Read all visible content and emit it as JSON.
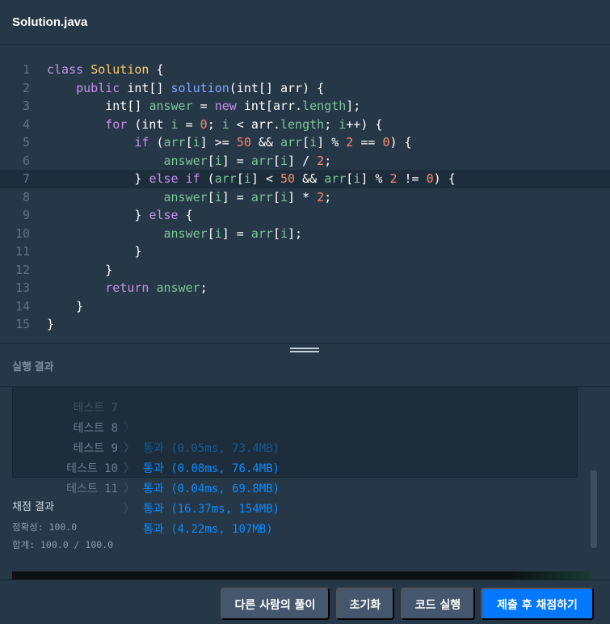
{
  "tab": {
    "title": "Solution.java"
  },
  "editor": {
    "line_numbers": [
      "1",
      "2",
      "3",
      "4",
      "5",
      "6",
      "7",
      "8",
      "9",
      "10",
      "11",
      "12",
      "13",
      "14",
      "15"
    ],
    "active_line": "7",
    "code_lines": [
      "class Solution {",
      "    public int[] solution(int[] arr) {",
      "        int[] answer = new int[arr.length];",
      "        for (int i = 0; i < arr.length; i++) {",
      "            if (arr[i] >= 50 && arr[i] % 2 == 0) {",
      "                answer[i] = arr[i] / 2;",
      "            } else if (arr[i] < 50 && arr[i] % 2 != 0) {",
      "                answer[i] = arr[i] * 2;",
      "            } else {",
      "                answer[i] = arr[i];",
      "            }",
      "        }",
      "        return answer;",
      "    }",
      "}"
    ]
  },
  "results": {
    "header": "실행 결과",
    "tests": [
      {
        "name": "테스트 7",
        "result": "통과 (0.05ms, 73.4MB)"
      },
      {
        "name": "테스트 8",
        "result": "통과 (0.08ms, 76.4MB)"
      },
      {
        "name": "테스트 9",
        "result": "통과 (0.04ms, 69.8MB)"
      },
      {
        "name": "테스트 10",
        "result": "통과 (16.37ms, 154MB)"
      },
      {
        "name": "테스트 11",
        "result": "통과 (4.22ms, 107MB)"
      }
    ],
    "chevron": "〉",
    "grading": {
      "title": "채점 결과",
      "accuracy": "정확성: 100.0",
      "total": "합계: 100.0 / 100.0"
    }
  },
  "footer": {
    "others_solutions": "다른 사람의 풀이",
    "reset": "초기화",
    "run_code": "코드 실행",
    "submit": "제출 후 채점하기"
  },
  "colors": {
    "background": "#263747",
    "pass": "#0b8cff",
    "primary_button": "#0078ff",
    "secondary_button": "#44576c"
  }
}
